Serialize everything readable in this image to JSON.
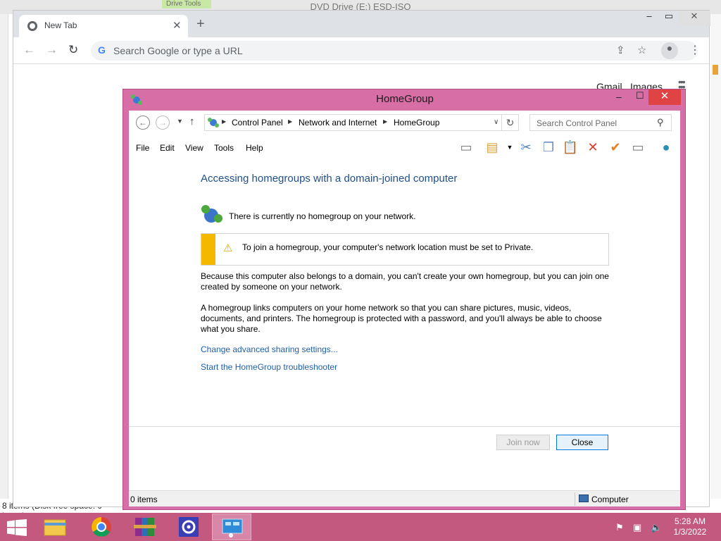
{
  "background_window": {
    "title": "DVD Drive (E:) ESD-ISO",
    "ribbon_tab": "Drive Tools",
    "status": "8 items (Disk free space: 0 bytes)"
  },
  "chrome": {
    "tab_title": "New Tab",
    "omnibox_placeholder": "Search Google or type a URL",
    "links": {
      "gmail": "Gmail",
      "images": "Images"
    }
  },
  "homegroup": {
    "title": "HomeGroup",
    "breadcrumbs": [
      "Control Panel",
      "Network and Internet",
      "HomeGroup"
    ],
    "search_placeholder": "Search Control Panel",
    "menu": [
      "File",
      "Edit",
      "View",
      "Tools",
      "Help"
    ],
    "heading": "Accessing homegroups with a domain-joined computer",
    "no_homegroup": "There is currently no homegroup on your network.",
    "warning": "To join a homegroup, your computer's network location must be set to Private.",
    "para1": "Because this computer also belongs to a domain, you can't create your own homegroup, but you can join one created by someone on your network.",
    "para2": "A homegroup links computers on your home network so that you can share pictures, music, videos, documents, and printers. The homegroup is protected with a password, and you'll always be able to choose what you share.",
    "link_sharing": "Change advanced sharing settings...",
    "link_troubleshooter": "Start the HomeGroup troubleshooter",
    "btn_join": "Join now",
    "btn_close": "Close",
    "status_items": "0 items",
    "status_location": "Computer"
  },
  "taskbar": {
    "time": "5:28 AM",
    "date": "1/3/2022",
    "accent_color": "#c3597f"
  }
}
